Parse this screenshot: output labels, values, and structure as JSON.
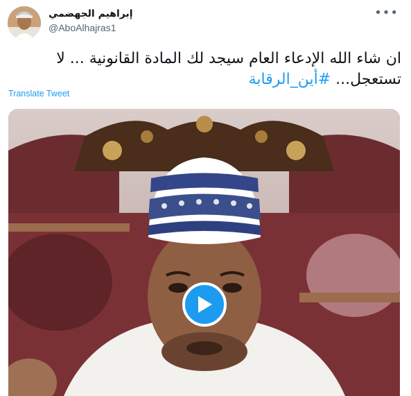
{
  "author": {
    "display_name": "إبراهيم الجهضمي",
    "handle": "@AboAlhajras1"
  },
  "more_icon": "•••",
  "tweet": {
    "text_main": "ان شاء الله الإدعاء العام سيجد لك المادة القانونية  ... لا تستعجل... ",
    "hashtag": "#أين_الرقابة"
  },
  "translate_label": "Translate Tweet",
  "media": {
    "type": "video",
    "play_icon": "play-icon"
  },
  "colors": {
    "accent": "#1d9bf0",
    "secondary_text": "#536471",
    "primary_text": "#0f1419"
  }
}
